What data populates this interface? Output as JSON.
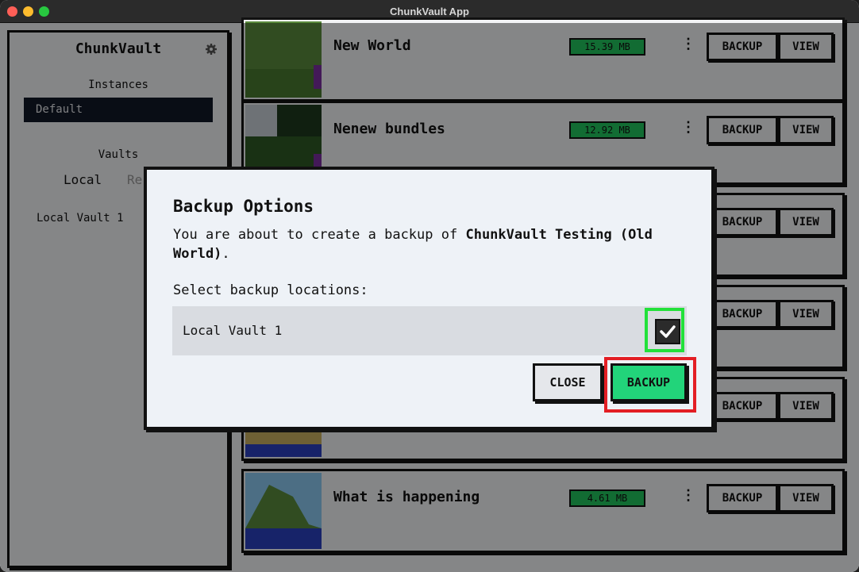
{
  "window": {
    "title": "ChunkVault App"
  },
  "sidebar": {
    "title": "ChunkVault",
    "instances_label": "Instances",
    "instance_selected": "Default",
    "vaults_label": "Vaults",
    "tabs": {
      "local": "Local",
      "remote": "Re"
    },
    "vault_items": [
      "Local Vault 1"
    ]
  },
  "worlds": [
    {
      "name": "New World",
      "size": "15.39 MB"
    },
    {
      "name": "Nenew bundles",
      "size": "12.92 MB"
    },
    {
      "name": "",
      "size": ""
    },
    {
      "name": "",
      "size": ""
    },
    {
      "name": "",
      "size": ""
    },
    {
      "name": "What is happening",
      "size": "4.61 MB"
    }
  ],
  "world_buttons": {
    "backup": "BACKUP",
    "view": "VIEW"
  },
  "modal": {
    "title": "Backup Options",
    "desc_prefix": "You are about to create a backup of ",
    "desc_bold": "ChunkVault Testing (Old World)",
    "desc_suffix": ".",
    "select_label": "Select backup locations:",
    "locations": [
      {
        "name": "Local Vault 1",
        "checked": true
      }
    ],
    "close_label": "CLOSE",
    "backup_label": "BACKUP"
  },
  "colors": {
    "accent_green": "#22c55e",
    "highlight_green": "#22e13a",
    "highlight_red": "#e31e24"
  }
}
